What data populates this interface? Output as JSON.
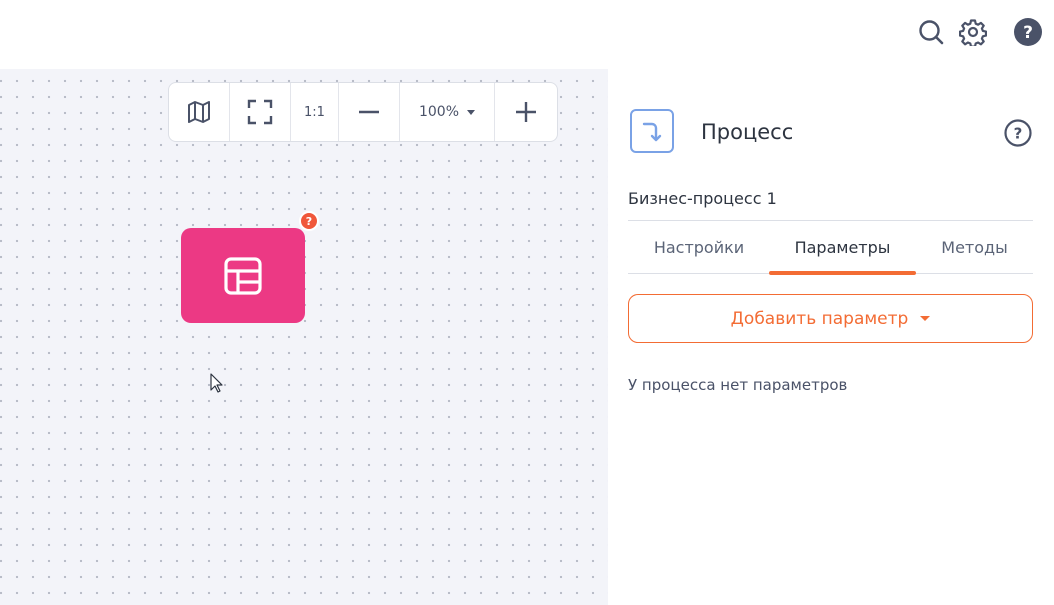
{
  "toolbar": {
    "one_to_one_label": "1:1",
    "zoom_value": "100%"
  },
  "node": {
    "badge": "?"
  },
  "panel": {
    "title": "Процесс",
    "process_name": "Бизнес-процесс 1",
    "tabs": [
      {
        "label": "Настройки"
      },
      {
        "label": "Параметры"
      },
      {
        "label": "Методы"
      }
    ],
    "add_button_label": "Добавить параметр",
    "empty_message": "У процесса нет параметров"
  },
  "colors": {
    "accent": "#f36c34",
    "node": "#ec3984",
    "badge": "#f0573a",
    "canvas": "#f3f4f9",
    "icon": "#4a5268"
  }
}
